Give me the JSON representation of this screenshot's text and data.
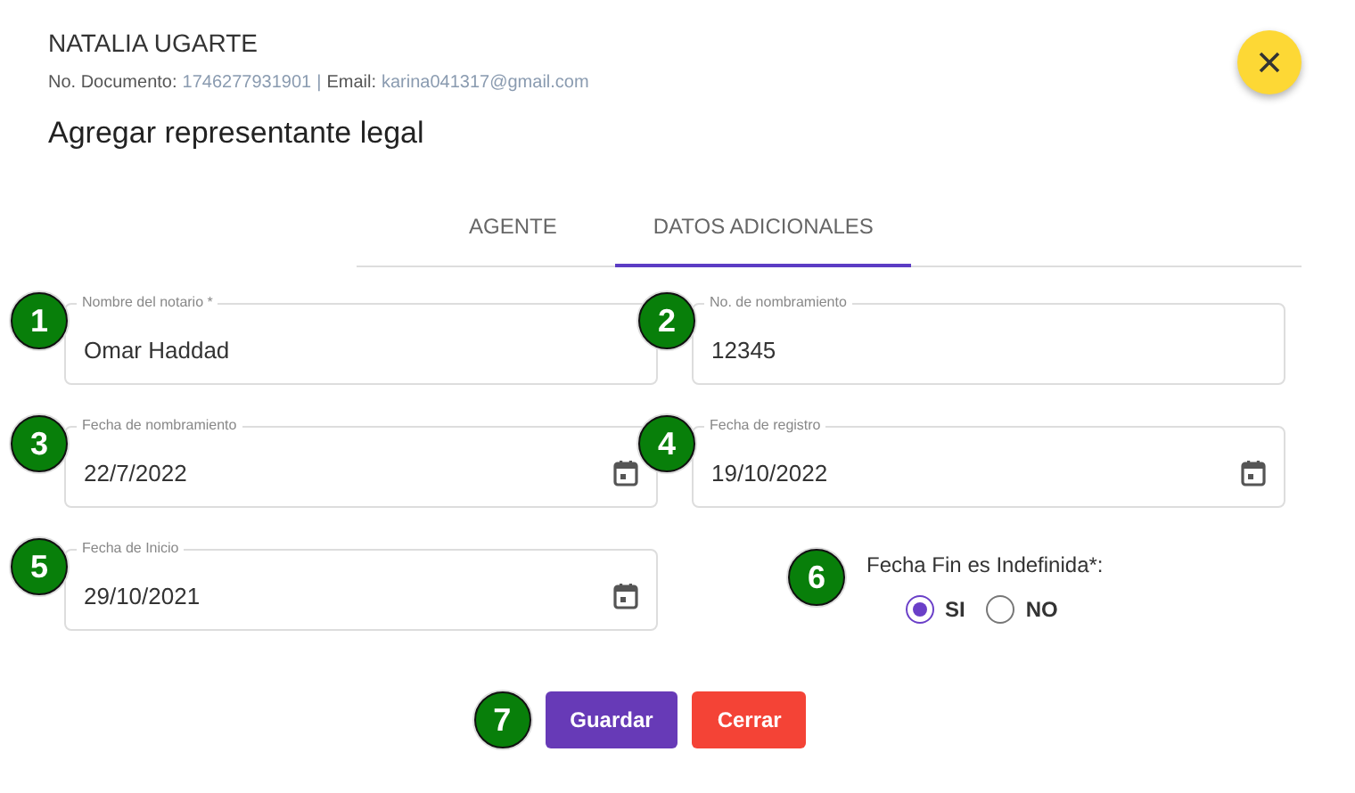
{
  "header": {
    "name": "NATALIA UGARTE",
    "doc_label": "No. Documento:",
    "doc_value": "1746277931901",
    "separator": "|",
    "email_label": "Email:",
    "email_value": "karina041317@gmail.com",
    "title": "Agregar representante legal"
  },
  "tabs": [
    {
      "label": "AGENTE",
      "selected": false
    },
    {
      "label": "DATOS ADICIONALES",
      "selected": true
    }
  ],
  "fields": [
    {
      "label": "Nombre del notario *",
      "value": "Omar Haddad",
      "kind": "text",
      "badge": "1"
    },
    {
      "label": "No. de nombramiento",
      "value": "12345",
      "kind": "text",
      "badge": "2"
    },
    {
      "label": "Fecha de nombramiento",
      "value": "22/7/2022",
      "kind": "date",
      "badge": "3"
    },
    {
      "label": "Fecha de registro",
      "value": "19/10/2022",
      "kind": "date",
      "badge": "4"
    },
    {
      "label": "Fecha de Inicio",
      "value": "29/10/2021",
      "kind": "date",
      "badge": "5"
    }
  ],
  "indefinite": {
    "label": "Fecha Fin es Indefinida*:",
    "badge": "6",
    "options": [
      {
        "label": "SI",
        "selected": true
      },
      {
        "label": "NO",
        "selected": false
      }
    ]
  },
  "actions": {
    "badge": "7",
    "buttons": [
      {
        "label": "Guardar",
        "kind": "primary"
      },
      {
        "label": "Cerrar",
        "kind": "danger"
      }
    ]
  }
}
